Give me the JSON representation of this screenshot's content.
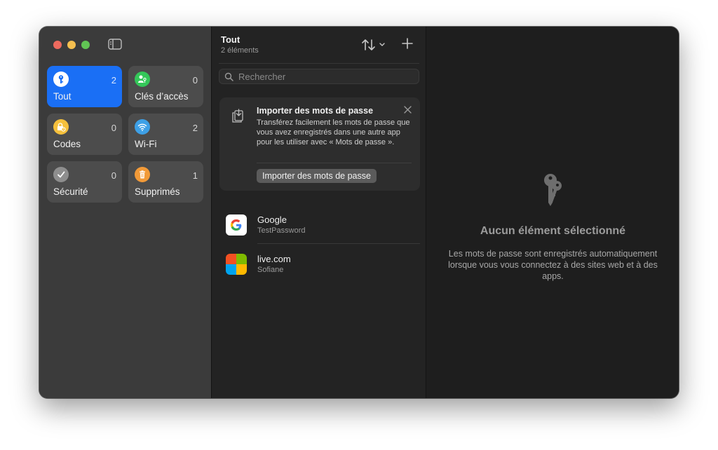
{
  "sidebar": {
    "tiles": [
      {
        "label": "Tout",
        "count": "2",
        "icon": "key-icon",
        "color": "#1a6ff5"
      },
      {
        "label": "Clés d’accès",
        "count": "0",
        "icon": "person-key-icon",
        "color": "#34c759"
      },
      {
        "label": "Codes",
        "count": "0",
        "icon": "lock-clock-icon",
        "color": "#f5c03c"
      },
      {
        "label": "Wi-Fi",
        "count": "2",
        "icon": "wifi-icon",
        "color": "#3ea0e6"
      },
      {
        "label": "Sécurité",
        "count": "0",
        "icon": "checkmark-icon",
        "color": "#8e8e8e"
      },
      {
        "label": "Supprimés",
        "count": "1",
        "icon": "trash-icon",
        "color": "#f29a38"
      }
    ]
  },
  "list": {
    "title": "Tout",
    "subtitle": "2 éléments",
    "search_placeholder": "Rechercher",
    "import_card": {
      "title": "Importer des mots de passe",
      "text": "Transférez facilement les mots de passe que vous avez enregistrés dans une autre app pour les utiliser avec « Mots de passe ».",
      "button": "Importer des mots de passe"
    },
    "entries": [
      {
        "name": "Google",
        "user": "TestPassword",
        "icon": "google-logo-icon"
      },
      {
        "name": "live.com",
        "user": "Sofiane",
        "icon": "microsoft-logo-icon"
      }
    ]
  },
  "detail": {
    "title": "Aucun élément sélectionné",
    "text": "Les mots de passe sont enregistrés automatiquement lorsque vous vous connectez à des sites web et à des apps."
  }
}
